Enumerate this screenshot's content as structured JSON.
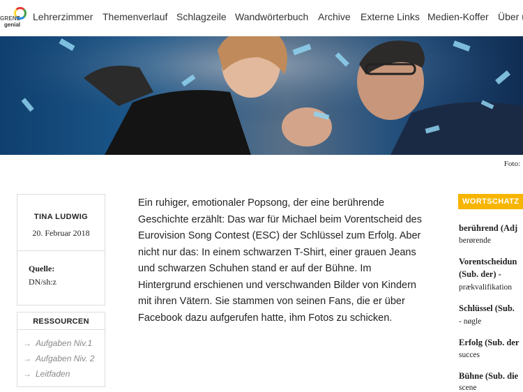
{
  "nav": {
    "logo_text_top": "GRENZ",
    "logo_text_bottom": "genial",
    "items": [
      {
        "label": "Lehrerzimmer"
      },
      {
        "label": "Themenverlauf"
      },
      {
        "label": "Schlagzeile"
      },
      {
        "label": "Wandwörterbuch"
      },
      {
        "label": "Archive"
      },
      {
        "label": "Externe Links"
      },
      {
        "label": "Medien-Koffer"
      },
      {
        "label": "Über u"
      }
    ]
  },
  "hero": {
    "caption": "Foto:"
  },
  "meta": {
    "author": "TINA LUDWIG",
    "date": "20. Februar 2018",
    "source_label": "Quelle:",
    "source_value": "DN/sh:z"
  },
  "resources": {
    "title": "RESSOURCEN",
    "items": [
      {
        "label": "Aufgaben Niv.1"
      },
      {
        "label": "Aufgaben Niv. 2"
      },
      {
        "label": "Leitfaden"
      }
    ]
  },
  "article": {
    "text": "Ein ruhiger, emotionaler Popsong, der eine berührende Geschichte erzählt: Das war für Michael beim Vorentscheid des Eurovision Song Contest (ESC) der Schlüssel zum Erfolg. Aber nicht nur das: In einem schwarzen T-Shirt, einer grauen Jeans und schwarzen Schuhen stand er auf der Bühne. Im Hintergrund erschienen und verschwanden Bilder von Kindern mit ihren Vätern. Sie stammen von seinen Fans, die er über Facebook dazu aufgerufen hatte, ihm Fotos zu schicken."
  },
  "vocab": {
    "title": "WORTSCHATZ",
    "entries": [
      {
        "term": "berührend (Adj",
        "translation": "berørende"
      },
      {
        "term": "Vorentscheidun",
        "term2": "(Sub. der) -",
        "translation": "prækvalifikation"
      },
      {
        "term": "Schlüssel (Sub.",
        "translation": "- nøgle"
      },
      {
        "term": "Erfolg (Sub. der",
        "translation": "succes"
      },
      {
        "term": "Bühne (Sub. die",
        "translation": "scene"
      }
    ]
  },
  "colors": {
    "accent": "#f7b500",
    "hero_blue": "#1d5a8e"
  }
}
